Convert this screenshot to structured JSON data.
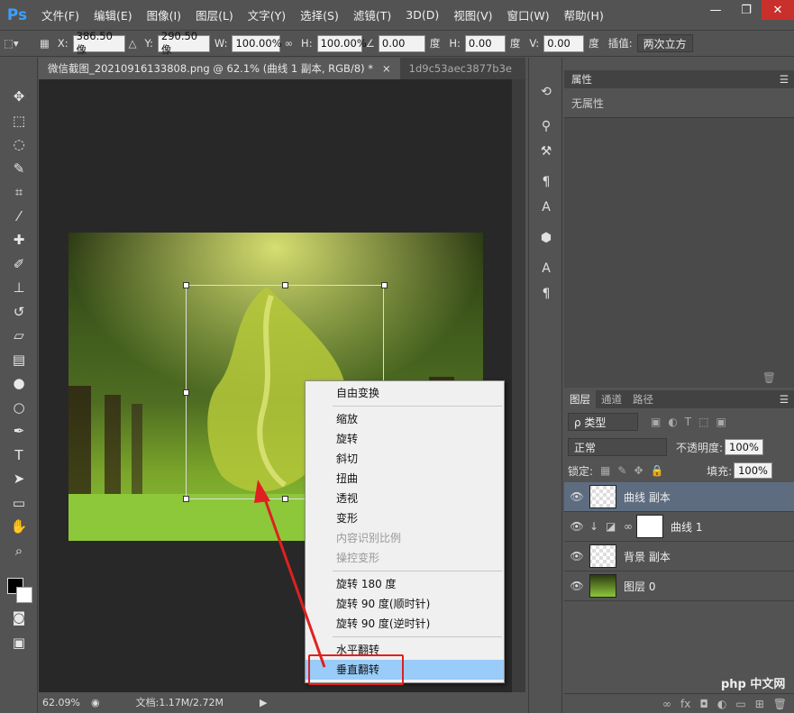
{
  "app": {
    "logo": "Ps"
  },
  "menu": [
    "文件(F)",
    "编辑(E)",
    "图像(I)",
    "图层(L)",
    "文字(Y)",
    "选择(S)",
    "滤镜(T)",
    "3D(D)",
    "视图(V)",
    "窗口(W)",
    "帮助(H)"
  ],
  "window_controls": {
    "minimize": "—",
    "restore": "❐",
    "close": "✕"
  },
  "options": {
    "x_label": "X:",
    "x_value": "386.50 像",
    "y_label": "Y:",
    "y_value": "290.50 像",
    "w_label": "W:",
    "w_value": "100.00%",
    "h_label": "H:",
    "h_value": "100.00%",
    "angle_value": "0.00",
    "angle_unit": "度",
    "hskew_label": "H:",
    "hskew_value": "0.00",
    "hskew_unit": "度",
    "vskew_label": "V:",
    "vskew_value": "0.00",
    "vskew_unit": "度",
    "interp_label": "插值:",
    "interp_value": "两次立方"
  },
  "document": {
    "active_tab": "微信截图_20210916133808.png @ 62.1% (曲线 1 副本, RGB/8) *",
    "close_glyph": "×",
    "inactive_tab": "1d9c53aec3877b3e",
    "zoom": "62.09%",
    "doc_size": "文档:1.17M/2.72M"
  },
  "context_menu": {
    "items_group1": [
      "自由变换"
    ],
    "items_group2": [
      "缩放",
      "旋转",
      "斜切",
      "扭曲",
      "透视",
      "变形"
    ],
    "items_group2_disabled": [
      "内容识别比例",
      "操控变形"
    ],
    "items_group3": [
      "旋转 180 度",
      "旋转 90 度(顺时针)",
      "旋转 90 度(逆时针)"
    ],
    "items_group4": [
      "水平翻转"
    ],
    "highlighted": "垂直翻转"
  },
  "properties": {
    "tab": "属性",
    "body": "无属性"
  },
  "layers": {
    "tabs": [
      "图层",
      "通道",
      "路径"
    ],
    "filter": "ρ 类型",
    "blend_mode": "正常",
    "opacity_label": "不透明度:",
    "opacity_value": "100%",
    "lock_label": "锁定:",
    "fill_label": "填充:",
    "fill_value": "100%",
    "rows": [
      {
        "name": "曲线 副本",
        "selected": true
      },
      {
        "name": "曲线 1",
        "selected": false
      },
      {
        "name": "背景 副本",
        "selected": false
      },
      {
        "name": "图层 0",
        "selected": false
      }
    ]
  },
  "watermark": "php 中文网"
}
